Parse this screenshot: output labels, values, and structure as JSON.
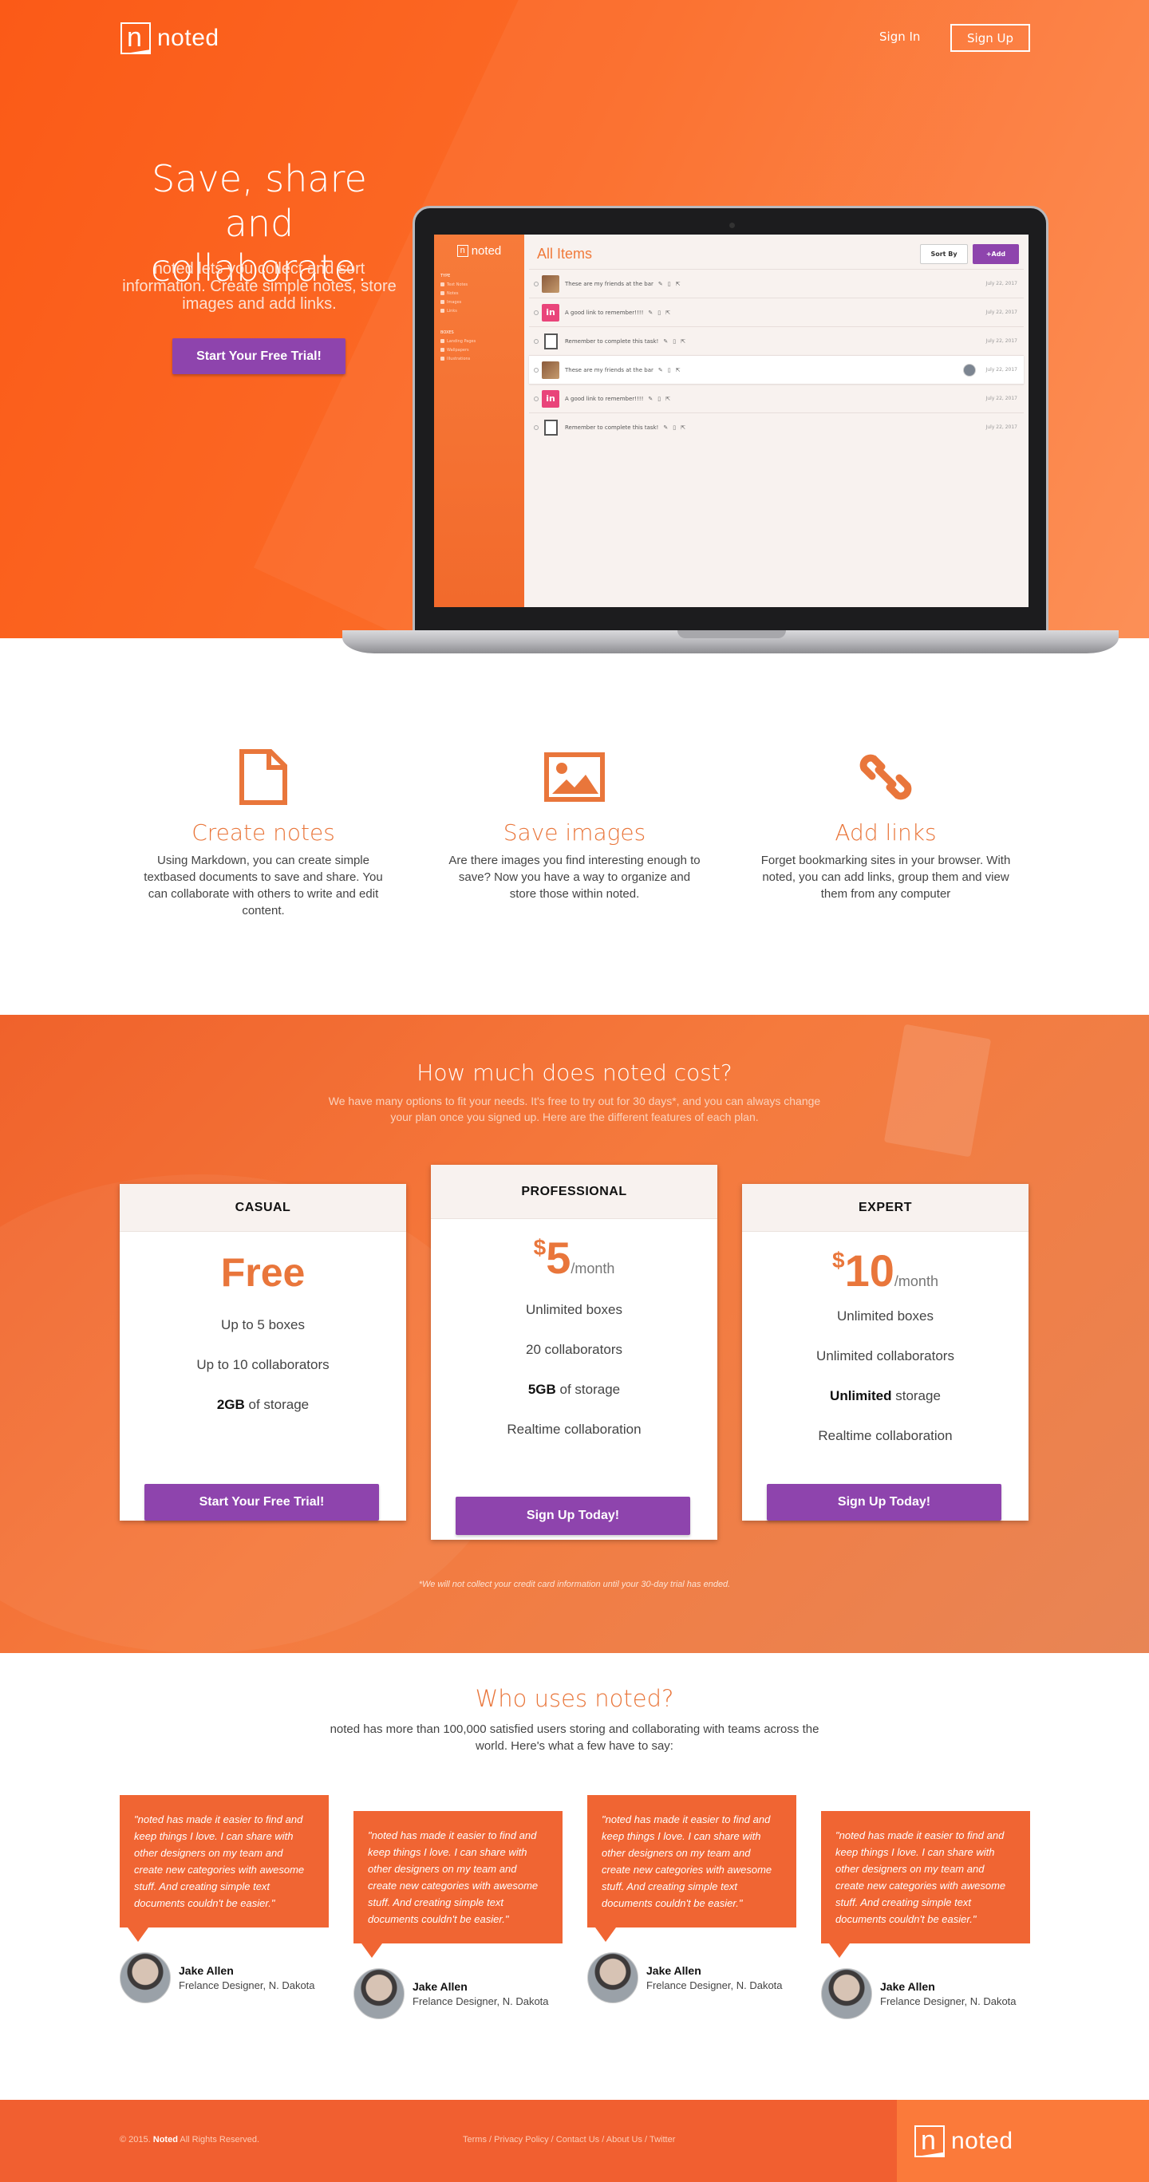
{
  "nav": {
    "brand": "noted",
    "signin": "Sign In",
    "signup": "Sign Up"
  },
  "hero": {
    "title": "Save, share and collaborate.",
    "subtitle": "noted lets you collect and sort information. Create simple notes, store images and add links.",
    "cta": "Start Your Free Trial!"
  },
  "app": {
    "brand": "noted",
    "title": "All Items",
    "sort_label": "Sort By",
    "add_label": "+Add",
    "sidebar": [
      {
        "section": "TYPE",
        "items": [
          "Text Notes",
          "Notes",
          "Images",
          "Links"
        ]
      },
      {
        "section": "BOXES",
        "items": [
          "Landing Pages",
          "Wallpapers",
          "Illustrations"
        ]
      }
    ],
    "rows": [
      {
        "kind": "img",
        "text": "These are my friends at the bar",
        "date": "July 22, 2017"
      },
      {
        "kind": "lnk",
        "text": "A good link to remember!!!!",
        "date": "July 22, 2017"
      },
      {
        "kind": "doc",
        "text": "Remember to complete this task!",
        "date": "July 22, 2017"
      },
      {
        "kind": "img",
        "text": "These are my friends at the bar",
        "date": "July 22, 2017",
        "selected": true
      },
      {
        "kind": "lnk",
        "text": "A good link to remember!!!!",
        "date": "July 22, 2017"
      },
      {
        "kind": "doc",
        "text": "Remember to complete this task!",
        "date": "July 22, 2017"
      }
    ]
  },
  "features": [
    {
      "icon": "document-icon",
      "title": "Create notes",
      "text": "Using Markdown, you can create simple textbased documents to save and share. You can collaborate with others to write and edit content."
    },
    {
      "icon": "image-icon",
      "title": "Save images",
      "text": "Are there images you find interesting enough to save? Now you have a way to organize and store those within noted."
    },
    {
      "icon": "link-icon",
      "title": "Add links",
      "text": "Forget bookmarking sites in your browser. With noted, you can add links, group them and view them from any computer"
    }
  ],
  "pricing": {
    "title": "How much does noted cost?",
    "subtitle": "We have many options to fit your needs. It's free to try out for 30 days*, and you can always change your plan once you signed up. Here are the different features of each plan.",
    "note": "*We will not collect your credit card information until your 30-day trial has ended.",
    "plans": [
      {
        "name": "CASUAL",
        "price": "Free",
        "features": [
          [
            "",
            "Up to 5 boxes"
          ],
          [
            "",
            "Up to 10 collaborators"
          ],
          [
            "2GB",
            " of storage"
          ]
        ],
        "cta": "Start Your Free Trial!"
      },
      {
        "name": "PROFESSIONAL",
        "currency": "$",
        "amount": "5",
        "period": "/month",
        "features": [
          [
            "",
            "Unlimited boxes"
          ],
          [
            "",
            "20 collaborators"
          ],
          [
            "5GB",
            " of storage"
          ],
          [
            "",
            "Realtime collaboration"
          ]
        ],
        "cta": "Sign Up Today!"
      },
      {
        "name": "EXPERT",
        "currency": "$",
        "amount": "10",
        "period": "/month",
        "features": [
          [
            "",
            "Unlimited boxes"
          ],
          [
            "",
            "Unlimited collaborators"
          ],
          [
            "Unlimited",
            " storage"
          ],
          [
            "",
            "Realtime collaboration"
          ]
        ],
        "cta": "Sign Up Today!"
      }
    ]
  },
  "testimonials": {
    "title": "Who uses noted?",
    "subtitle": "noted has more than 100,000 satisfied users storing and collaborating with teams across the world. Here's what a few have to say:",
    "items": [
      {
        "quote": "\"noted has made it easier to find and keep things I love. I can share with other designers on my team and create new categories with awesome stuff. And creating simple text documents couldn't be easier.\"",
        "name": "Jake Allen",
        "role": "Frelance Designer, N. Dakota"
      },
      {
        "quote": "\"noted has made it easier to find and keep things I love. I can share with other designers on my team and create new categories with awesome stuff. And creating simple text documents couldn't be easier.\"",
        "name": "Jake Allen",
        "role": "Frelance Designer, N. Dakota"
      },
      {
        "quote": "\"noted has made it easier to find and keep things I love. I can share with other designers on my team and create new categories with awesome stuff. And creating simple text documents couldn't be easier.\"",
        "name": "Jake Allen",
        "role": "Frelance Designer, N. Dakota"
      },
      {
        "quote": "\"noted has made it easier to find and keep things I love. I can share with other designers on my team and create new categories with awesome stuff. And creating simple text documents couldn't be easier.\"",
        "name": "Jake Allen",
        "role": "Frelance Designer, N. Dakota"
      }
    ]
  },
  "footer": {
    "copy_prefix": "© 2015.",
    "copy_brand": "Noted",
    "copy_suffix": "All Rights Reserved.",
    "links": [
      "Terms",
      "Privacy Policy",
      "Contact Us",
      "About Us",
      "Twitter"
    ],
    "brand": "noted"
  },
  "colors": {
    "orange": "#fb5a17",
    "accent": "#e9763b",
    "purple": "#8e44ad",
    "footer": "#f15f30"
  }
}
